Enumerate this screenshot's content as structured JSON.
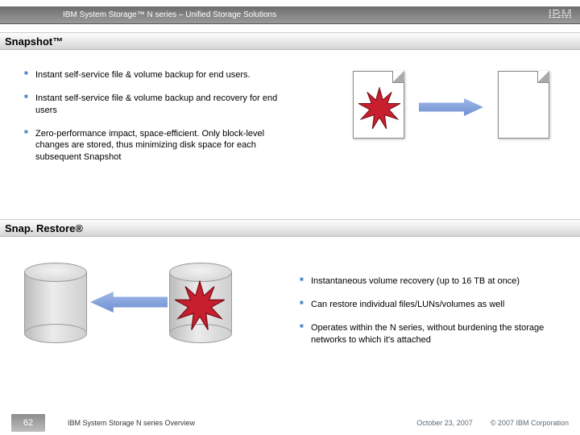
{
  "header": {
    "title": "IBM System Storage™ N series – Unified Storage Solutions",
    "logo_text": "IBM"
  },
  "sections": {
    "snapshot": {
      "heading": "Snapshot™",
      "bullets": [
        "Instant self-service file & volume backup for end users.",
        "Instant self-service file & volume backup and recovery for end users",
        "Zero-performance impact, space-efficient.  Only block-level changes are stored, thus minimizing disk space for each subsequent Snapshot"
      ]
    },
    "snaprestore": {
      "heading": "Snap. Restore®",
      "bullets": [
        "Instantaneous volume recovery (up to 16 TB at once)",
        "Can restore individual files/LUNs/volumes as well",
        "Operates within the N series, without burdening the storage networks to which it's attached"
      ]
    }
  },
  "footer": {
    "page": "62",
    "title": "IBM System Storage N series Overview",
    "date": "October 23, 2007",
    "copyright": "© 2007 IBM Corporation"
  }
}
